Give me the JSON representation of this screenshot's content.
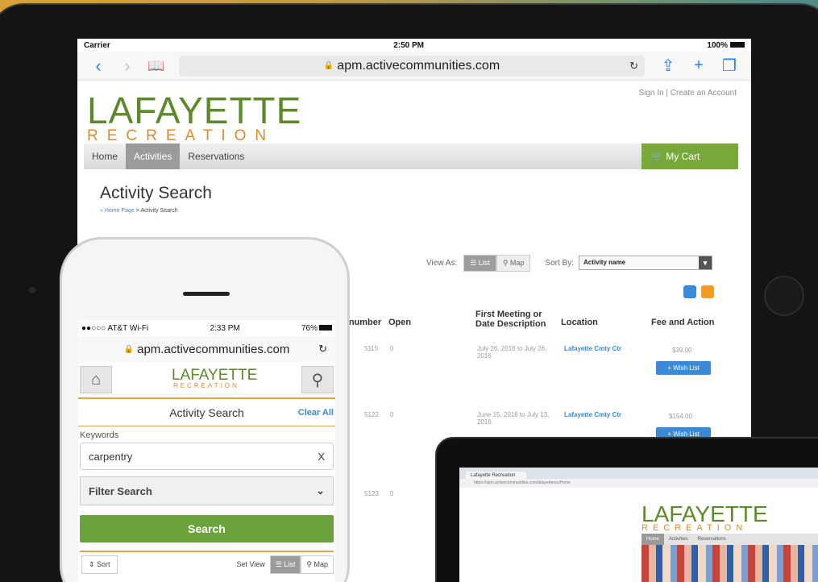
{
  "ipad": {
    "status": {
      "carrier": "Carrier",
      "time": "2:50 PM",
      "battery": "100%"
    },
    "url": "apm.activecommunities.com",
    "logo_main": "LAFAYETTE",
    "logo_sub": "RECREATION",
    "account": "Sign In | Create an Account",
    "menu": [
      "Home",
      "Activities",
      "Reservations"
    ],
    "cart": "My Cart",
    "page_title": "Activity Search",
    "breadcrumb_home": "» Home Page",
    "breadcrumb_current": "> Activity Search",
    "view_as": "View As:",
    "view_list": "List",
    "view_map": "Map",
    "sort_by": "Sort By:",
    "sort_value": "Activity name",
    "columns": [
      "ty number",
      "Open",
      "First Meeting or Date Description",
      "Location",
      "Fee and Action"
    ],
    "rows": [
      {
        "number": "5115",
        "open": "0",
        "date": "July 26, 2016 to July 26, 2016",
        "location": "Lafayette Cmty Ctr",
        "fee": "$39.00",
        "action": "+ Wish List"
      },
      {
        "number": "5122",
        "open": "0",
        "date": "June 15, 2016 to July 13, 2016",
        "location": "Lafayette Cmty Ctr",
        "fee": "$154.00",
        "action": "+ Wish List"
      },
      {
        "number": "5123",
        "open": "0"
      }
    ]
  },
  "iphone": {
    "status": {
      "carrier": "●●○○○ AT&T Wi-Fi",
      "time": "2:33 PM",
      "battery": "76%"
    },
    "url": "apm.activecommunities.com",
    "logo_main": "LAFAYETTE",
    "logo_sub": "RECREATION",
    "search_title": "Activity Search",
    "clear_all": "Clear All",
    "keywords_label": "Keywords",
    "keywords_value": "carpentry",
    "clear_x": "X",
    "filter_search": "Filter Search",
    "search_button": "Search",
    "sort": "⇕ Sort",
    "set_view": "Set View",
    "view_list": "List",
    "view_map": "Map"
  },
  "laptop": {
    "tab": "Lafayette Recreation",
    "url": "https://apm.activecommunities.com/lafayetterec/Home",
    "logo_main": "LAFAYETTE",
    "logo_sub": "RECREATION",
    "menu": [
      "Home",
      "Activities",
      "Reservations"
    ]
  },
  "colors": {
    "brand_green": "#5c8a2a",
    "brand_orange": "#e0882a",
    "link_blue": "#3a88d6",
    "cart_green": "#79a83a"
  }
}
